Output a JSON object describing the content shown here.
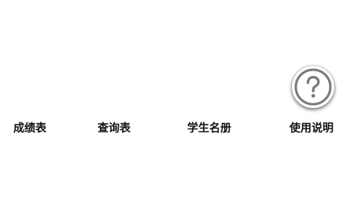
{
  "menu": {
    "items": [
      {
        "label": "成绩表"
      },
      {
        "label": "查询表"
      },
      {
        "label": "学生名册"
      },
      {
        "label": "使用说明"
      }
    ],
    "active_item_icon": "question-circle-icon",
    "icon_color": "#7a7a7a"
  }
}
